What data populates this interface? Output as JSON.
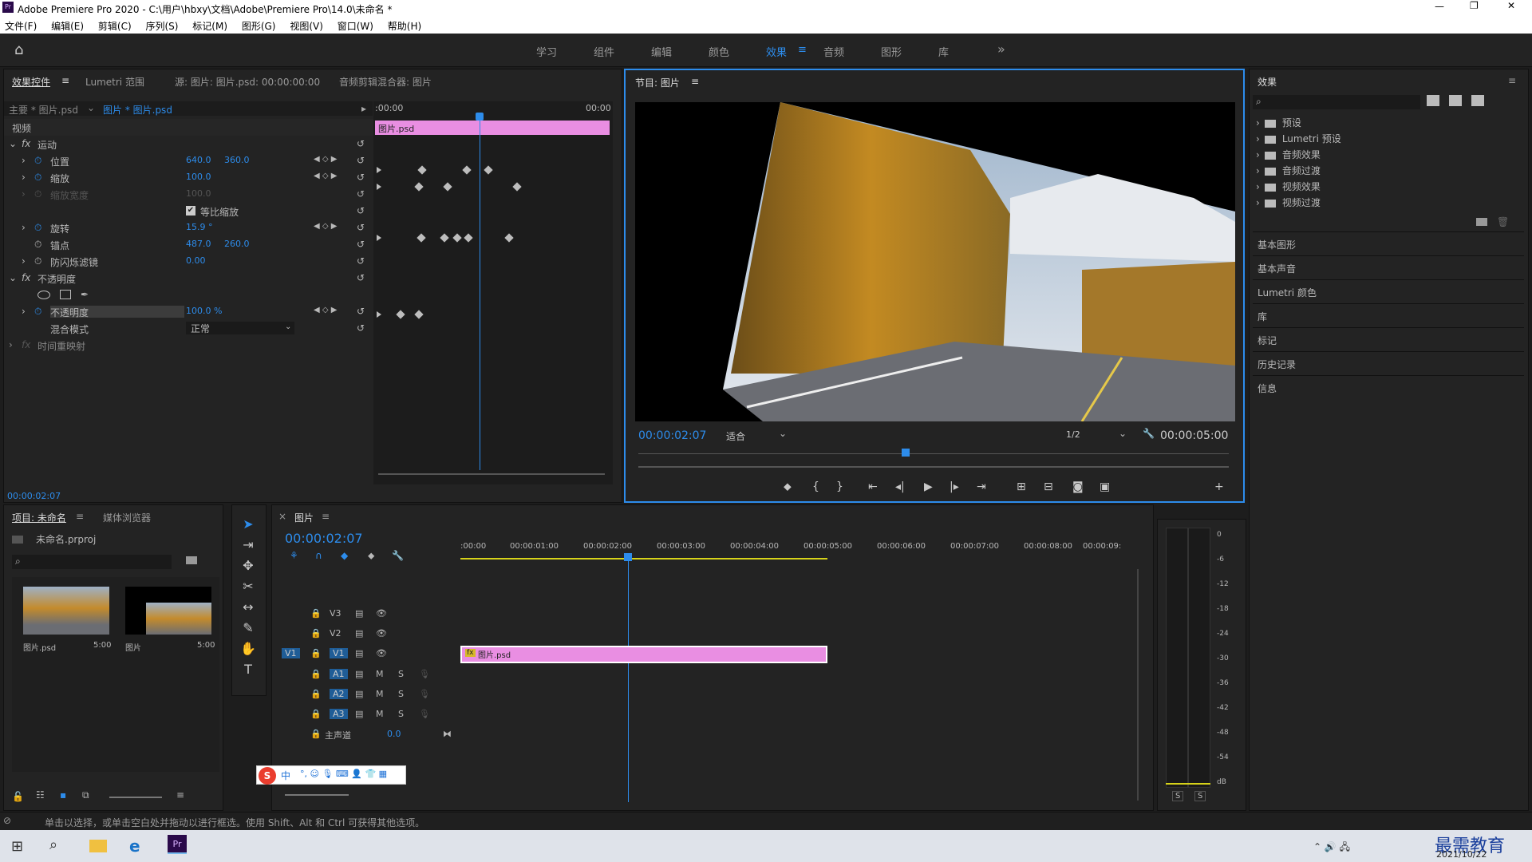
{
  "window": {
    "title": "Adobe Premiere Pro 2020 - C:\\用户\\hbxy\\文档\\Adobe\\Premiere Pro\\14.0\\未命名 *",
    "app_icon": "Pr"
  },
  "menu": [
    "文件(F)",
    "编辑(E)",
    "剪辑(C)",
    "序列(S)",
    "标记(M)",
    "图形(G)",
    "视图(V)",
    "窗口(W)",
    "帮助(H)"
  ],
  "workspaces": {
    "items": [
      "学习",
      "组件",
      "编辑",
      "颜色",
      "效果",
      "音频",
      "图形",
      "库"
    ],
    "active": "效果",
    "more": "»"
  },
  "effect_controls": {
    "tabs": [
      "效果控件",
      "Lumetri 范围",
      "源: 图片: 图片.psd: 00:00:00:00",
      "音频剪辑混合器: 图片"
    ],
    "master": "主要 * 图片.psd",
    "clip": "图片 * 图片.psd",
    "ruler_start": ":00:00",
    "ruler_end": "00:00",
    "clip_bar": "图片.psd",
    "section_video": "视频",
    "motion": "运动",
    "props": {
      "position": {
        "label": "位置",
        "x": "640.0",
        "y": "360.0"
      },
      "scale": {
        "label": "缩放",
        "v": "100.0"
      },
      "scale_width": {
        "label": "缩放宽度",
        "v": "100.0"
      },
      "uniform": "等比缩放",
      "rotation": {
        "label": "旋转",
        "v": "15.9 °"
      },
      "anchor": {
        "label": "锚点",
        "x": "487.0",
        "y": "260.0"
      },
      "flicker": {
        "label": "防闪烁滤镜",
        "v": "0.00"
      }
    },
    "opacity_section": "不透明度",
    "opacity": {
      "label": "不透明度",
      "v": "100.0 %"
    },
    "blend": {
      "label": "混合模式",
      "v": "正常"
    },
    "time_remap": "时间重映射",
    "timecode": "00:00:02:07"
  },
  "program": {
    "title": "节目: 图片",
    "timecode": "00:00:02:07",
    "fit": "适合",
    "res": "1/2",
    "duration": "00:00:05:00"
  },
  "effects_panel": {
    "title": "效果",
    "tree": [
      "预设",
      "Lumetri 预设",
      "音频效果",
      "音频过渡",
      "视频效果",
      "视频过渡"
    ],
    "sections": [
      "基本图形",
      "基本声音",
      "Lumetri 颜色",
      "库",
      "标记",
      "历史记录",
      "信息"
    ]
  },
  "project": {
    "tabs": [
      "项目: 未命名",
      "媒体浏览器"
    ],
    "file": "未命名.prproj",
    "items": [
      {
        "name": "图片.psd",
        "dur": "5:00"
      },
      {
        "name": "图片",
        "dur": "5:00"
      }
    ]
  },
  "timeline": {
    "tab": "图片",
    "timecode": "00:00:02:07",
    "ruler": [
      ":00:00",
      "00:00:01:00",
      "00:00:02:00",
      "00:00:03:00",
      "00:00:04:00",
      "00:00:05:00",
      "00:00:06:00",
      "00:00:07:00",
      "00:00:08:00",
      "00:00:09:"
    ],
    "tracks": [
      "V3",
      "V2",
      "V1",
      "A1",
      "A2",
      "A3"
    ],
    "source_patch": "V1",
    "master": "主声道",
    "master_val": "0.0",
    "clip": "图片.psd",
    "ms": [
      "M",
      "S"
    ]
  },
  "meter": {
    "scale": [
      "0",
      "-6",
      "-12",
      "-18",
      "-24",
      "-30",
      "-36",
      "-42",
      "-48",
      "-54",
      "dB"
    ],
    "solo": [
      "S",
      "S"
    ]
  },
  "ime": {
    "label": "中"
  },
  "status": "单击以选择，或单击空白处并拖动以进行框选。使用 Shift、Alt 和 Ctrl 可获得其他选项。",
  "taskbar": {
    "date": "2021/10/22",
    "watermark": "最需教育"
  }
}
